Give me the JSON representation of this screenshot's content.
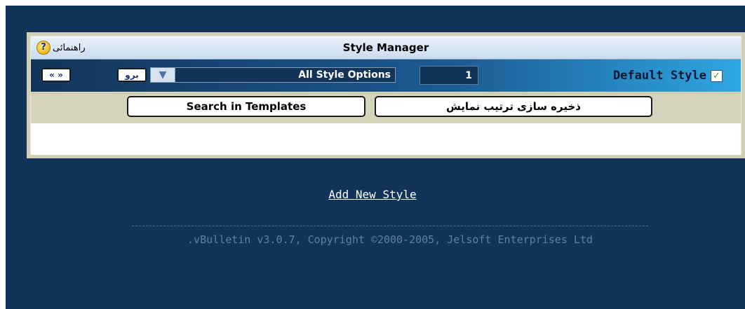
{
  "header": {
    "title": "Style Manager",
    "help_label": "راهنمائی",
    "help_icon": "?"
  },
  "controls": {
    "nav_arrows_label": "« »",
    "go_label": "برو",
    "dropdown_value": "All Style Options",
    "display_order_value": "1",
    "default_style_label": "Default Style",
    "default_style_checked": true
  },
  "actions": {
    "search_templates_label": "Search in Templates",
    "save_display_order_label": "ذخیره سازی ترتیب نمایش"
  },
  "links": {
    "add_new_style": "Add New Style"
  },
  "footer": {
    "copyright": ".vBulletin v3.0.7, Copyright ©2000-2005, Jelsoft Enterprises Ltd"
  },
  "colors": {
    "page_background": "#133459",
    "panel_border": "#d2cfb7",
    "accent_cyan": "#2ea7e2"
  }
}
